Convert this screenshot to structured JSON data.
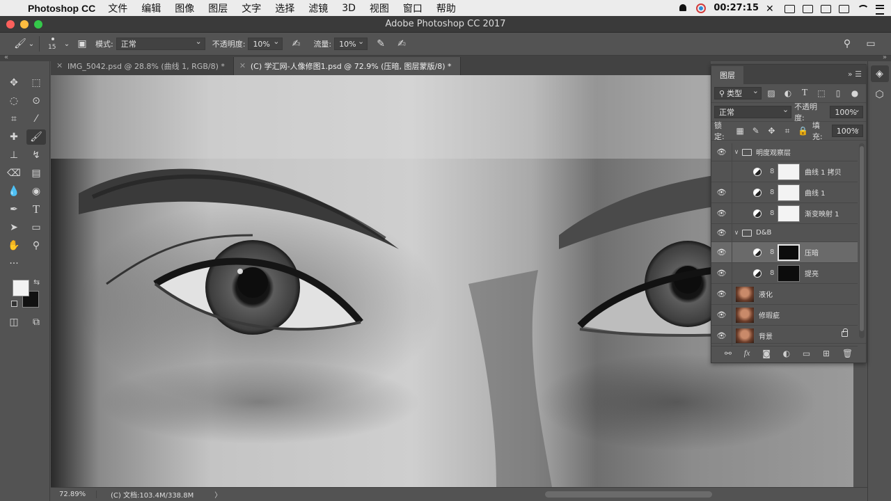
{
  "menubar": {
    "app_name": "Photoshop CC",
    "items": [
      "文件",
      "编辑",
      "图像",
      "图层",
      "文字",
      "选择",
      "滤镜",
      "3D",
      "视图",
      "窗口",
      "帮助"
    ],
    "clock": "00:27:15"
  },
  "window": {
    "title": "Adobe Photoshop CC 2017"
  },
  "options": {
    "brush_size": "15",
    "mode_label": "模式:",
    "mode_value": "正常",
    "opacity_label": "不透明度:",
    "opacity_value": "10%",
    "flow_label": "流量:",
    "flow_value": "10%"
  },
  "tabs": [
    {
      "label": "IMG_5042.psd @ 28.8% (曲线 1, RGB/8) *",
      "active": false
    },
    {
      "label": "(C) 学汇网-人像修图1.psd @ 72.9% (压暗, 图层蒙版/8) *",
      "active": true
    }
  ],
  "status": {
    "zoom": "72.89%",
    "doc_info": "(C) 文档:103.4M/338.8M",
    "more": "〉"
  },
  "layers_panel": {
    "tab_label": "图层",
    "filter_label": "类型",
    "blend_mode": "正常",
    "opacity_label": "不透明度:",
    "opacity_value": "100%",
    "lock_label": "锁定:",
    "fill_label": "填充:",
    "fill_value": "100%",
    "layers": [
      {
        "name": "明度观察层",
        "kind": "group",
        "visible": true
      },
      {
        "name": "曲线 1 拷贝",
        "kind": "adjust",
        "visible": false,
        "mask": "white"
      },
      {
        "name": "曲线 1",
        "kind": "adjust",
        "visible": true,
        "mask": "white"
      },
      {
        "name": "渐变映射 1",
        "kind": "adjust",
        "visible": true,
        "mask": "white"
      },
      {
        "name": "D&B",
        "kind": "group",
        "visible": true
      },
      {
        "name": "压暗",
        "kind": "adjust",
        "visible": true,
        "mask": "black",
        "selected": true
      },
      {
        "name": "提亮",
        "kind": "adjust",
        "visible": true,
        "mask": "black"
      },
      {
        "name": "液化",
        "kind": "pixel",
        "visible": true
      },
      {
        "name": "修瑕疵",
        "kind": "pixel",
        "visible": true
      },
      {
        "name": "背景",
        "kind": "pixel",
        "visible": true,
        "locked": true
      }
    ]
  },
  "colors": {
    "foreground": "#f2f2f2",
    "background": "#111111",
    "panel_bg": "#535353"
  }
}
